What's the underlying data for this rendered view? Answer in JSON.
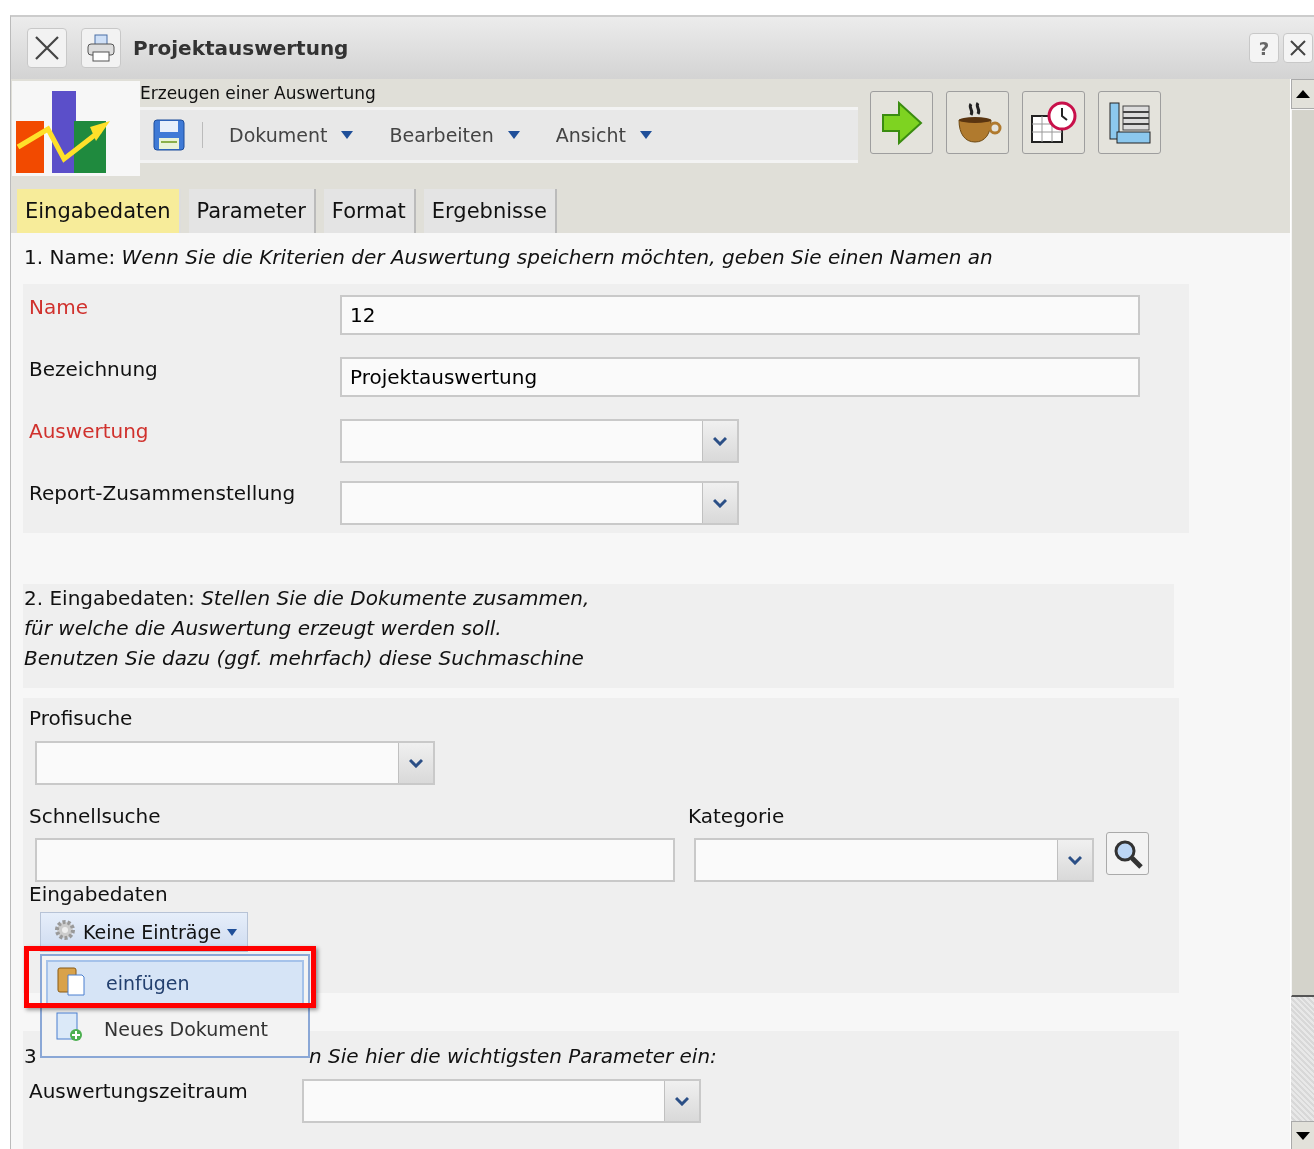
{
  "window": {
    "title": "Projektauswertung",
    "help_label": "?"
  },
  "header": {
    "subtitle": "Erzeugen einer Auswertung",
    "menus": [
      {
        "label": "Dokument"
      },
      {
        "label": "Bearbeiten"
      },
      {
        "label": "Ansicht"
      }
    ],
    "actions": [
      {
        "kind": "run"
      },
      {
        "kind": "pause"
      },
      {
        "kind": "schedule"
      },
      {
        "kind": "layout"
      }
    ]
  },
  "tabs": [
    {
      "label": "Eingabedaten",
      "selected": true
    },
    {
      "label": "Parameter",
      "selected": false
    },
    {
      "label": "Format",
      "selected": false
    },
    {
      "label": "Ergebnisse",
      "selected": false
    }
  ],
  "section_1": {
    "heading": "1. Name: *Wenn Sie die Kriterien der Auswertung speichern möchten, geben Sie einen Namen an*",
    "rows": [
      {
        "label": "Name",
        "required": true,
        "kind": "text",
        "value": "12"
      },
      {
        "label": "Bezeichnung",
        "required": false,
        "kind": "text",
        "value": "Projektauswertung"
      },
      {
        "label": "Auswertung",
        "required": true,
        "kind": "select"
      },
      {
        "label": "Report-Zusammenstellung",
        "required": false,
        "kind": "select"
      }
    ]
  },
  "section_2": {
    "heading_lines": [
      "2. Eingabedaten: *Stellen Sie die Dokumente zusammen,*",
      "*für welche die Auswertung erzeugt werden soll.*",
      "*Benutzen Sie dazu (ggf. mehrfach) diese Suchmaschine*"
    ],
    "profisuche": {
      "label": "Profisuche"
    },
    "schnellsuche": {
      "label": "Schnellsuche"
    },
    "kategorie": {
      "label": "Kategorie"
    },
    "input_label": "Eingabedaten",
    "menu_button": {
      "label": "Keine Einträge",
      "expanded": true
    },
    "menu_items": [
      {
        "label": "einfügen",
        "kind": "paste",
        "selected": true,
        "annotated": true
      },
      {
        "label": "Neues Dokument",
        "kind": "new",
        "selected": false,
        "annotated": false
      }
    ]
  },
  "section_3": {
    "heading_start": "3",
    "heading_visible": "n Sie hier die wichtigsten Parameter ein:",
    "rows": [
      {
        "label": "Auswertungszeitraum",
        "required": false,
        "kind": "select"
      }
    ]
  }
}
